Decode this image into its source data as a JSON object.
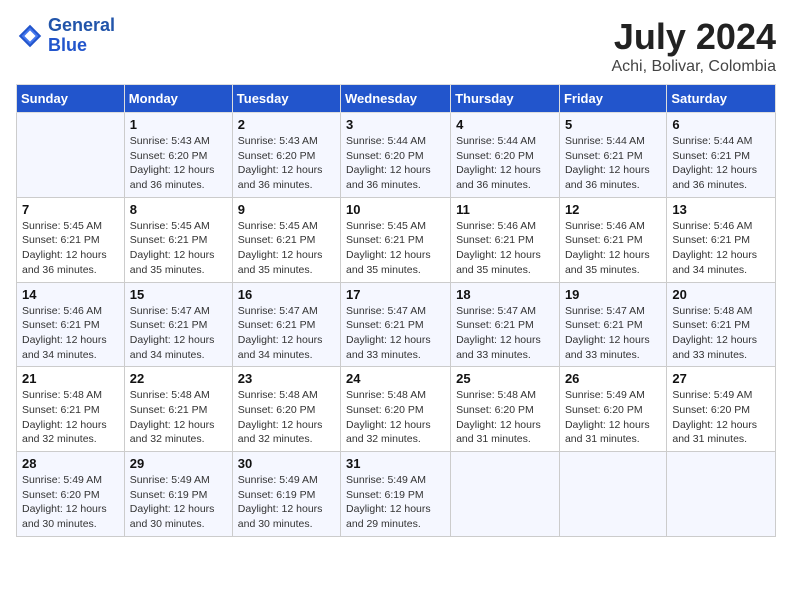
{
  "header": {
    "logo_line1": "General",
    "logo_line2": "Blue",
    "month": "July 2024",
    "location": "Achi, Bolivar, Colombia"
  },
  "weekdays": [
    "Sunday",
    "Monday",
    "Tuesday",
    "Wednesday",
    "Thursday",
    "Friday",
    "Saturday"
  ],
  "weeks": [
    [
      {
        "day": "",
        "info": ""
      },
      {
        "day": "1",
        "info": "Sunrise: 5:43 AM\nSunset: 6:20 PM\nDaylight: 12 hours\nand 36 minutes."
      },
      {
        "day": "2",
        "info": "Sunrise: 5:43 AM\nSunset: 6:20 PM\nDaylight: 12 hours\nand 36 minutes."
      },
      {
        "day": "3",
        "info": "Sunrise: 5:44 AM\nSunset: 6:20 PM\nDaylight: 12 hours\nand 36 minutes."
      },
      {
        "day": "4",
        "info": "Sunrise: 5:44 AM\nSunset: 6:20 PM\nDaylight: 12 hours\nand 36 minutes."
      },
      {
        "day": "5",
        "info": "Sunrise: 5:44 AM\nSunset: 6:21 PM\nDaylight: 12 hours\nand 36 minutes."
      },
      {
        "day": "6",
        "info": "Sunrise: 5:44 AM\nSunset: 6:21 PM\nDaylight: 12 hours\nand 36 minutes."
      }
    ],
    [
      {
        "day": "7",
        "info": "Sunrise: 5:45 AM\nSunset: 6:21 PM\nDaylight: 12 hours\nand 36 minutes."
      },
      {
        "day": "8",
        "info": "Sunrise: 5:45 AM\nSunset: 6:21 PM\nDaylight: 12 hours\nand 35 minutes."
      },
      {
        "day": "9",
        "info": "Sunrise: 5:45 AM\nSunset: 6:21 PM\nDaylight: 12 hours\nand 35 minutes."
      },
      {
        "day": "10",
        "info": "Sunrise: 5:45 AM\nSunset: 6:21 PM\nDaylight: 12 hours\nand 35 minutes."
      },
      {
        "day": "11",
        "info": "Sunrise: 5:46 AM\nSunset: 6:21 PM\nDaylight: 12 hours\nand 35 minutes."
      },
      {
        "day": "12",
        "info": "Sunrise: 5:46 AM\nSunset: 6:21 PM\nDaylight: 12 hours\nand 35 minutes."
      },
      {
        "day": "13",
        "info": "Sunrise: 5:46 AM\nSunset: 6:21 PM\nDaylight: 12 hours\nand 34 minutes."
      }
    ],
    [
      {
        "day": "14",
        "info": "Sunrise: 5:46 AM\nSunset: 6:21 PM\nDaylight: 12 hours\nand 34 minutes."
      },
      {
        "day": "15",
        "info": "Sunrise: 5:47 AM\nSunset: 6:21 PM\nDaylight: 12 hours\nand 34 minutes."
      },
      {
        "day": "16",
        "info": "Sunrise: 5:47 AM\nSunset: 6:21 PM\nDaylight: 12 hours\nand 34 minutes."
      },
      {
        "day": "17",
        "info": "Sunrise: 5:47 AM\nSunset: 6:21 PM\nDaylight: 12 hours\nand 33 minutes."
      },
      {
        "day": "18",
        "info": "Sunrise: 5:47 AM\nSunset: 6:21 PM\nDaylight: 12 hours\nand 33 minutes."
      },
      {
        "day": "19",
        "info": "Sunrise: 5:47 AM\nSunset: 6:21 PM\nDaylight: 12 hours\nand 33 minutes."
      },
      {
        "day": "20",
        "info": "Sunrise: 5:48 AM\nSunset: 6:21 PM\nDaylight: 12 hours\nand 33 minutes."
      }
    ],
    [
      {
        "day": "21",
        "info": "Sunrise: 5:48 AM\nSunset: 6:21 PM\nDaylight: 12 hours\nand 32 minutes."
      },
      {
        "day": "22",
        "info": "Sunrise: 5:48 AM\nSunset: 6:21 PM\nDaylight: 12 hours\nand 32 minutes."
      },
      {
        "day": "23",
        "info": "Sunrise: 5:48 AM\nSunset: 6:20 PM\nDaylight: 12 hours\nand 32 minutes."
      },
      {
        "day": "24",
        "info": "Sunrise: 5:48 AM\nSunset: 6:20 PM\nDaylight: 12 hours\nand 32 minutes."
      },
      {
        "day": "25",
        "info": "Sunrise: 5:48 AM\nSunset: 6:20 PM\nDaylight: 12 hours\nand 31 minutes."
      },
      {
        "day": "26",
        "info": "Sunrise: 5:49 AM\nSunset: 6:20 PM\nDaylight: 12 hours\nand 31 minutes."
      },
      {
        "day": "27",
        "info": "Sunrise: 5:49 AM\nSunset: 6:20 PM\nDaylight: 12 hours\nand 31 minutes."
      }
    ],
    [
      {
        "day": "28",
        "info": "Sunrise: 5:49 AM\nSunset: 6:20 PM\nDaylight: 12 hours\nand 30 minutes."
      },
      {
        "day": "29",
        "info": "Sunrise: 5:49 AM\nSunset: 6:19 PM\nDaylight: 12 hours\nand 30 minutes."
      },
      {
        "day": "30",
        "info": "Sunrise: 5:49 AM\nSunset: 6:19 PM\nDaylight: 12 hours\nand 30 minutes."
      },
      {
        "day": "31",
        "info": "Sunrise: 5:49 AM\nSunset: 6:19 PM\nDaylight: 12 hours\nand 29 minutes."
      },
      {
        "day": "",
        "info": ""
      },
      {
        "day": "",
        "info": ""
      },
      {
        "day": "",
        "info": ""
      }
    ]
  ]
}
